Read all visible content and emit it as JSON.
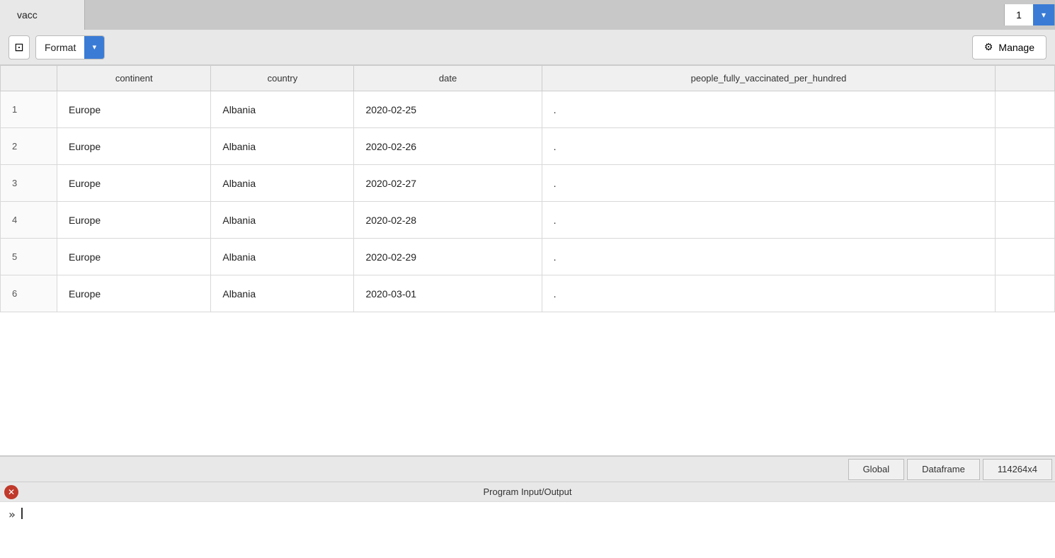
{
  "tab": {
    "label": "vacc",
    "number": "1"
  },
  "toolbar": {
    "copy_icon": "⊡",
    "format_label": "Format",
    "dropdown_icon": "▾",
    "manage_icon": "⚙",
    "manage_label": "Manage"
  },
  "table": {
    "columns": [
      "",
      "continent",
      "country",
      "date",
      "people_fully_vaccinated_per_hundred"
    ],
    "rows": [
      {
        "num": "1",
        "continent": "Europe",
        "country": "Albania",
        "date": "2020-02-25",
        "value": "."
      },
      {
        "num": "2",
        "continent": "Europe",
        "country": "Albania",
        "date": "2020-02-26",
        "value": "."
      },
      {
        "num": "3",
        "continent": "Europe",
        "country": "Albania",
        "date": "2020-02-27",
        "value": "."
      },
      {
        "num": "4",
        "continent": "Europe",
        "country": "Albania",
        "date": "2020-02-28",
        "value": "."
      },
      {
        "num": "5",
        "continent": "Europe",
        "country": "Albania",
        "date": "2020-02-29",
        "value": "."
      },
      {
        "num": "6",
        "continent": "Europe",
        "country": "Albania",
        "date": "2020-03-01",
        "value": "."
      }
    ]
  },
  "status": {
    "global_label": "Global",
    "dataframe_label": "Dataframe",
    "size_label": "114264x4"
  },
  "program_io": {
    "title": "Program Input/Output",
    "close_icon": "✕",
    "prompt": "»"
  }
}
